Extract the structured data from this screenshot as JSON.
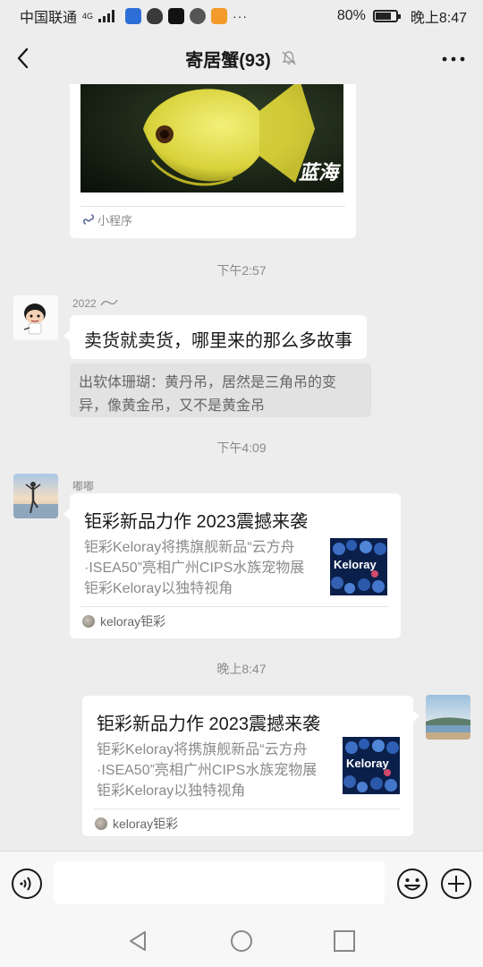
{
  "status_bar": {
    "carrier": "中国联通",
    "network": "4G",
    "battery": "80%",
    "battery_level": 0.8,
    "time": "晚上8:47"
  },
  "nav": {
    "title": "寄居蟹(93)",
    "back_icon": "chevron-left-icon",
    "mute_icon": "bell-muted-icon",
    "more_icon": "more-dots-icon"
  },
  "messages": {
    "miniprogram": {
      "watermark": "蓝海",
      "label": "小程序"
    },
    "time1": "下午2:57",
    "msg1": {
      "nickname": "2022",
      "text": "卖货就卖货，哪里来的那么多故事",
      "quote": "出软体珊瑚：黄丹吊，居然是三角吊的变异，像黄金吊，又不是黄金吊"
    },
    "time2": "下午4:09",
    "msg2": {
      "nickname": "嘟嘟",
      "title": "钜彩新品力作 2023震撼来袭",
      "desc": "钜彩Keloray将携旗舰新品“云方舟·ISEA50”亮相广州CIPS水族宠物展 钜彩Keloray以独特视角",
      "thumb_text": "Keloray",
      "source": "keloray钜彩"
    },
    "time3": "晚上8:47",
    "msg3": {
      "title": "钜彩新品力作 2023震撼来袭",
      "desc": "钜彩Keloray将携旗舰新品“云方舟·ISEA50”亮相广州CIPS水族宠物展 钜彩Keloray以独特视角",
      "thumb_text": "Keloray",
      "source": "keloray钜彩"
    }
  },
  "input_bar": {
    "voice_icon": "voice-icon",
    "emoji_icon": "emoji-icon",
    "plus_icon": "plus-icon"
  },
  "colors": {
    "background": "#ededed",
    "bubble": "#ffffff",
    "quote_bg": "#e2e2e2",
    "text": "#191919",
    "muted": "#8a8a8a"
  }
}
